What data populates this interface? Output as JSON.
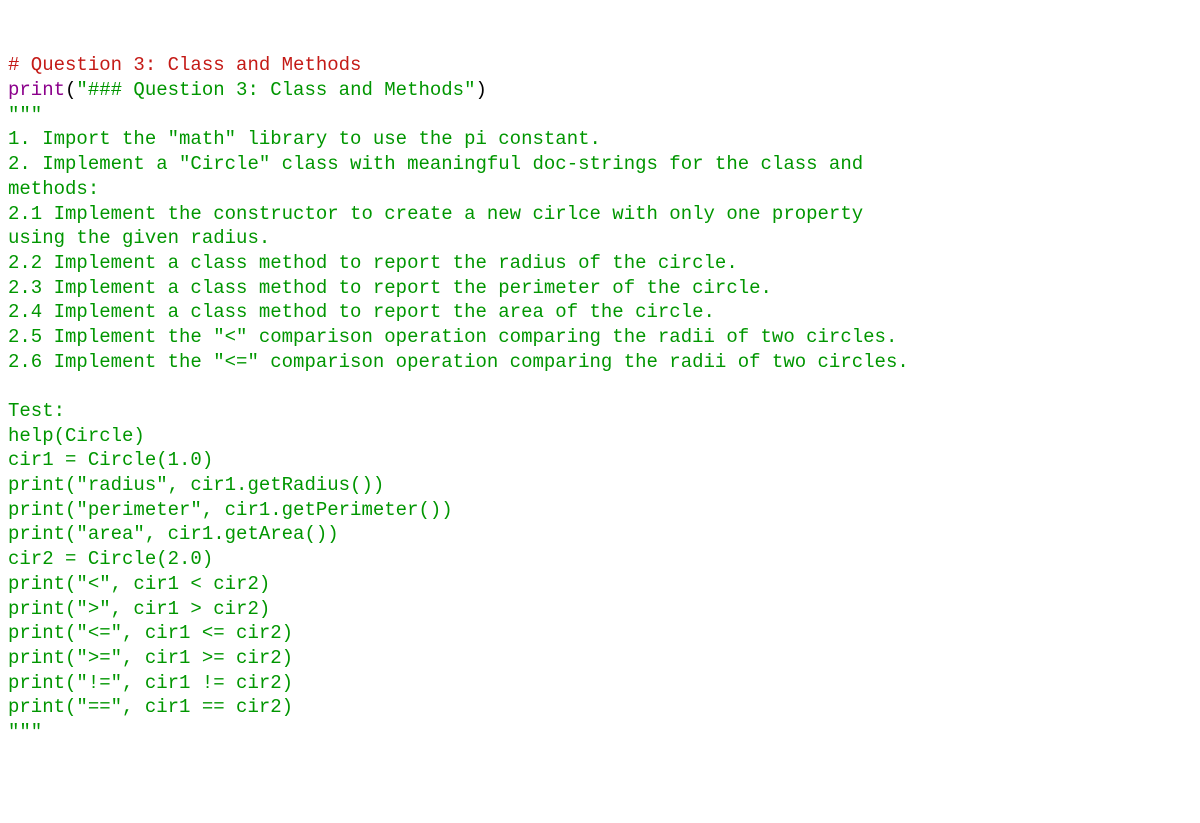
{
  "code": {
    "comment": "# Question 3: Class and Methods",
    "print_kw": "print",
    "lparen": "(",
    "print_arg": "\"### Question 3: Class and Methods\"",
    "rparen": ")",
    "tq_open": "\"\"\"",
    "doc_line1": "1. Import the \"math\" library to use the pi constant.",
    "doc_line2": "2. Implement a \"Circle\" class with meaningful doc-strings for the class and",
    "doc_line3": "methods:",
    "doc_line4": "2.1 Implement the constructor to create a new cirlce with only one property",
    "doc_line5": "using the given radius.",
    "doc_line6": "2.2 Implement a class method to report the radius of the circle.",
    "doc_line7": "2.3 Implement a class method to report the perimeter of the circle.",
    "doc_line8": "2.4 Implement a class method to report the area of the circle.",
    "doc_line9": "2.5 Implement the \"<\" comparison operation comparing the radii of two circles.",
    "doc_line10": "2.6 Implement the \"<=\" comparison operation comparing the radii of two circles.",
    "doc_blank": "",
    "doc_test": "Test:",
    "doc_t1": "help(Circle)",
    "doc_t2": "cir1 = Circle(1.0)",
    "doc_t3": "print(\"radius\", cir1.getRadius())",
    "doc_t4": "print(\"perimeter\", cir1.getPerimeter())",
    "doc_t5": "print(\"area\", cir1.getArea())",
    "doc_t6": "cir2 = Circle(2.0)",
    "doc_t7": "print(\"<\", cir1 < cir2)",
    "doc_t8": "print(\">\", cir1 > cir2)",
    "doc_t9": "print(\"<=\", cir1 <= cir2)",
    "doc_t10": "print(\">=\", cir1 >= cir2)",
    "doc_t11": "print(\"!=\", cir1 != cir2)",
    "doc_t12": "print(\"==\", cir1 == cir2)",
    "tq_close": "\"\"\""
  }
}
